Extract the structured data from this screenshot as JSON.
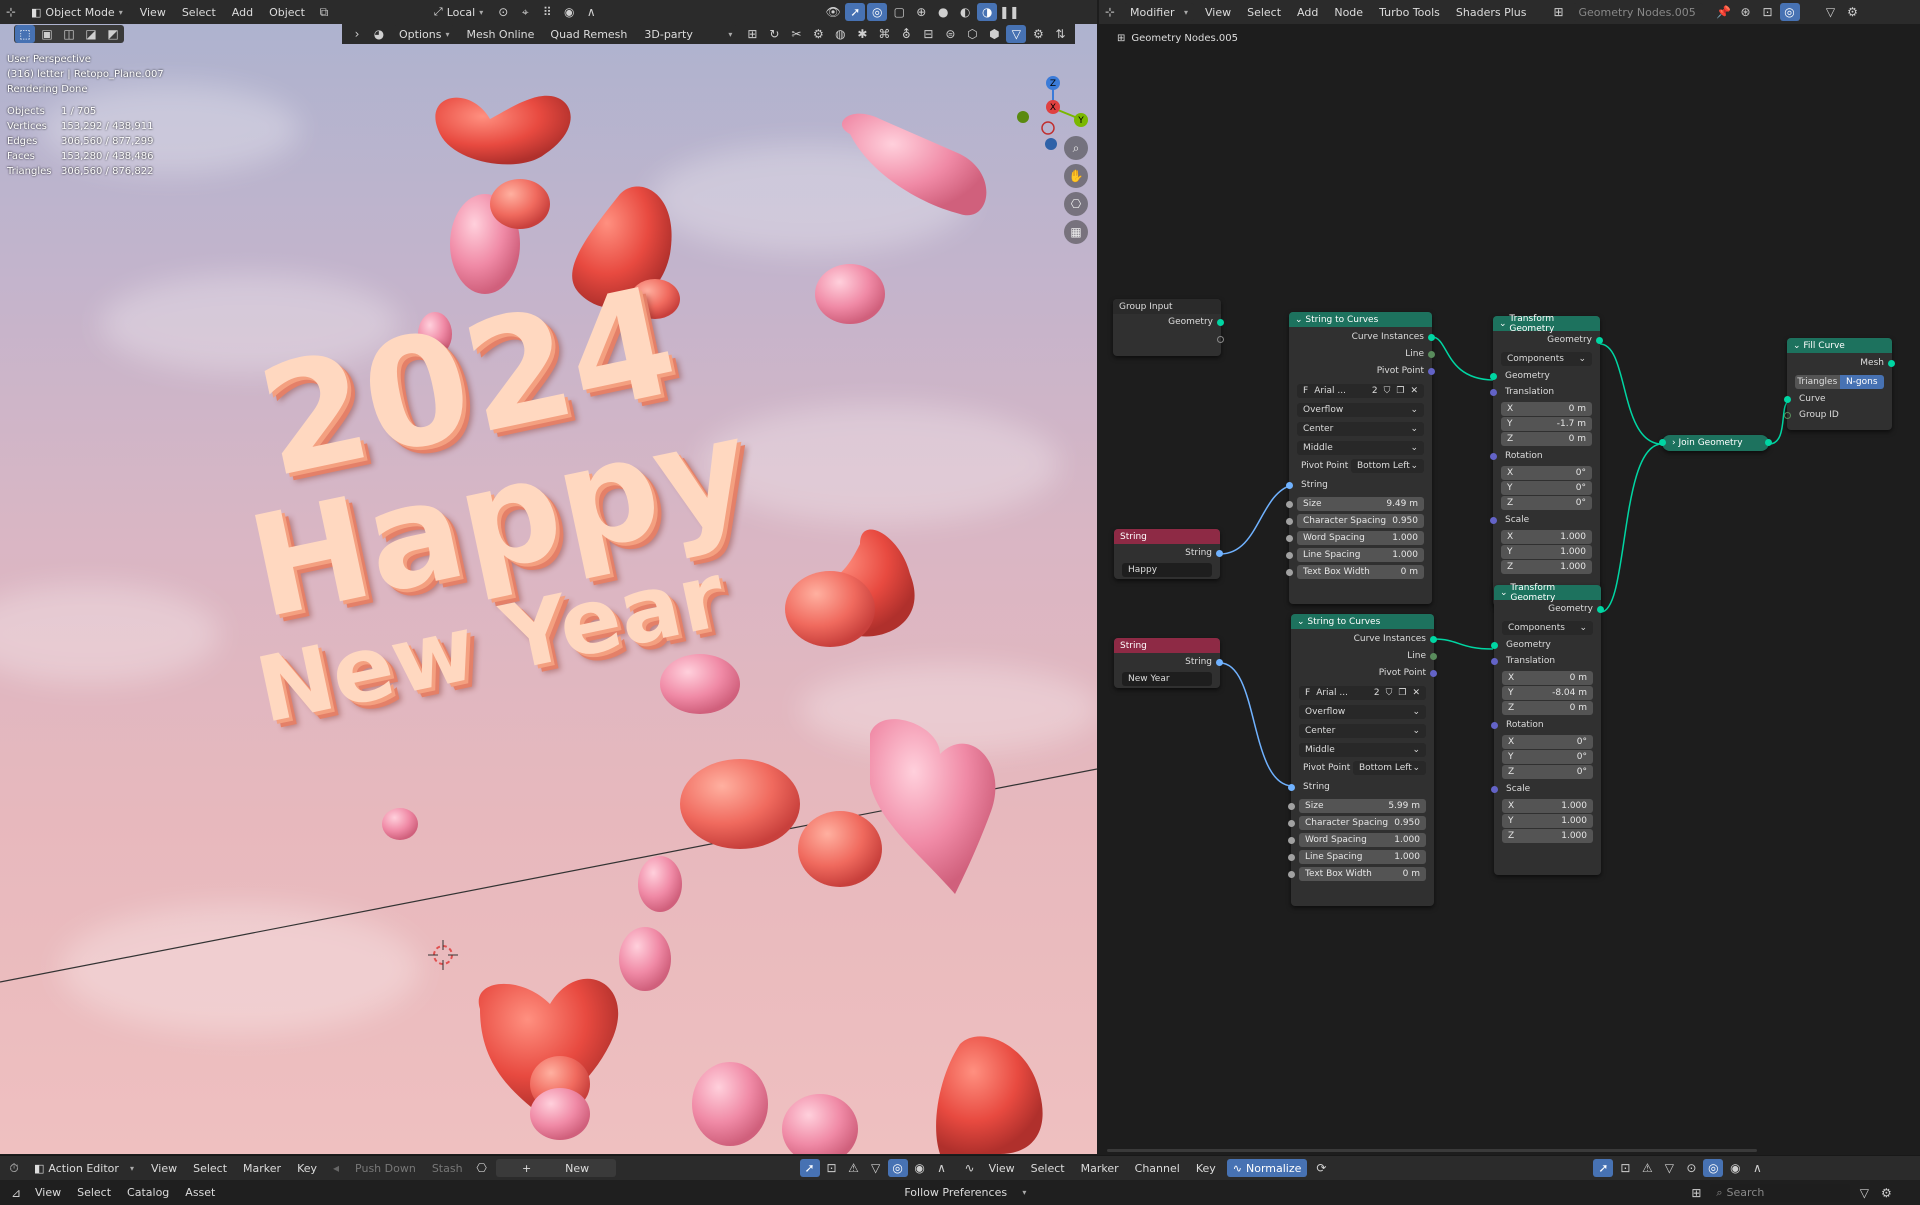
{
  "viewport_header": {
    "mode": "Object Mode",
    "menus": [
      "View",
      "Select",
      "Add",
      "Object"
    ],
    "transform_orientation": "Local"
  },
  "viewport_header2": {
    "options": "Options",
    "addon1": "Mesh Online",
    "addon2": "Quad Remesh",
    "addon3": "3D-party"
  },
  "stats": {
    "perspective": "User Perspective",
    "object_line": "(316) letter | Retopo_Plane.007",
    "render": "Rendering Done",
    "rows": [
      {
        "k": "Objects",
        "v": "1 / 705"
      },
      {
        "k": "Vertices",
        "v": "153,292 / 438,911"
      },
      {
        "k": "Edges",
        "v": "306,560 / 877,299"
      },
      {
        "k": "Faces",
        "v": "153,280 / 438,486"
      },
      {
        "k": "Triangles",
        "v": "306,560 / 876,822"
      }
    ]
  },
  "scene_text": {
    "line1": "2024",
    "line2": "Happy",
    "line3": "New Year"
  },
  "node_header": {
    "editor": "Modifier",
    "menus": [
      "View",
      "Select",
      "Add",
      "Node",
      "Turbo Tools",
      "Shaders Plus"
    ],
    "tree_name": "Geometry Nodes.005",
    "breadcrumb": "Geometry Nodes.005"
  },
  "nodes": {
    "group_input": {
      "title": "Group Input",
      "geometry": "Geometry"
    },
    "string1": {
      "title": "String",
      "out": "String",
      "value": "Happy"
    },
    "string2": {
      "title": "String",
      "out": "String",
      "value": "New Year"
    },
    "s2c1": {
      "title": "String to Curves",
      "out1": "Curve Instances",
      "out2": "Line",
      "out3": "Pivot Point",
      "font": "Arial ...",
      "users": "2",
      "overflow": "Overflow",
      "align_x": "Center",
      "align_y": "Middle",
      "pivot_label": "Pivot Point",
      "pivot": "Bottom Left",
      "string": "String",
      "fields": [
        {
          "k": "Size",
          "v": "9.49 m"
        },
        {
          "k": "Character Spacing",
          "v": "0.950"
        },
        {
          "k": "Word Spacing",
          "v": "1.000"
        },
        {
          "k": "Line Spacing",
          "v": "1.000"
        },
        {
          "k": "Text Box Width",
          "v": "0 m"
        }
      ]
    },
    "s2c2": {
      "title": "String to Curves",
      "out1": "Curve Instances",
      "out2": "Line",
      "out3": "Pivot Point",
      "font": "Arial ...",
      "users": "2",
      "overflow": "Overflow",
      "align_x": "Center",
      "align_y": "Middle",
      "pivot_label": "Pivot Point",
      "pivot": "Bottom Left",
      "string": "String",
      "fields": [
        {
          "k": "Size",
          "v": "5.99 m"
        },
        {
          "k": "Character Spacing",
          "v": "0.950"
        },
        {
          "k": "Word Spacing",
          "v": "1.000"
        },
        {
          "k": "Line Spacing",
          "v": "1.000"
        },
        {
          "k": "Text Box Width",
          "v": "0 m"
        }
      ]
    },
    "tg1": {
      "title": "Transform Geometry",
      "out": "Geometry",
      "mode": "Components",
      "geometry": "Geometry",
      "translation": "Translation",
      "tx": "0 m",
      "ty": "-1.7 m",
      "tz": "0 m",
      "rotation": "Rotation",
      "rx": "0°",
      "ry": "0°",
      "rz": "0°",
      "scale": "Scale",
      "sx": "1.000",
      "sy": "1.000",
      "sz": "1.000"
    },
    "tg2": {
      "title": "Transform Geometry",
      "out": "Geometry",
      "mode": "Components",
      "geometry": "Geometry",
      "translation": "Translation",
      "tx": "0 m",
      "ty": "-8.04 m",
      "tz": "0 m",
      "rotation": "Rotation",
      "rx": "0°",
      "ry": "0°",
      "rz": "0°",
      "scale": "Scale",
      "sx": "1.000",
      "sy": "1.000",
      "sz": "1.000"
    },
    "join": {
      "title": "Join Geometry"
    },
    "fill": {
      "title": "Fill Curve",
      "out": "Mesh",
      "opt1": "Triangles",
      "opt2": "N-gons",
      "in1": "Curve",
      "in2": "Group ID"
    },
    "axis": {
      "x": "X",
      "y": "Y",
      "z": "Z"
    }
  },
  "bottom1": {
    "editor": "Action Editor",
    "menus": [
      "View",
      "Select",
      "Marker",
      "Key"
    ],
    "push": "Push Down",
    "stash": "Stash",
    "new": "New",
    "menus2": [
      "View",
      "Select",
      "Marker",
      "Channel",
      "Key"
    ],
    "normalize": "Normalize"
  },
  "bottom2": {
    "menus": [
      "View",
      "Select",
      "Catalog",
      "Asset"
    ],
    "follow": "Follow Preferences",
    "search": "Search"
  }
}
